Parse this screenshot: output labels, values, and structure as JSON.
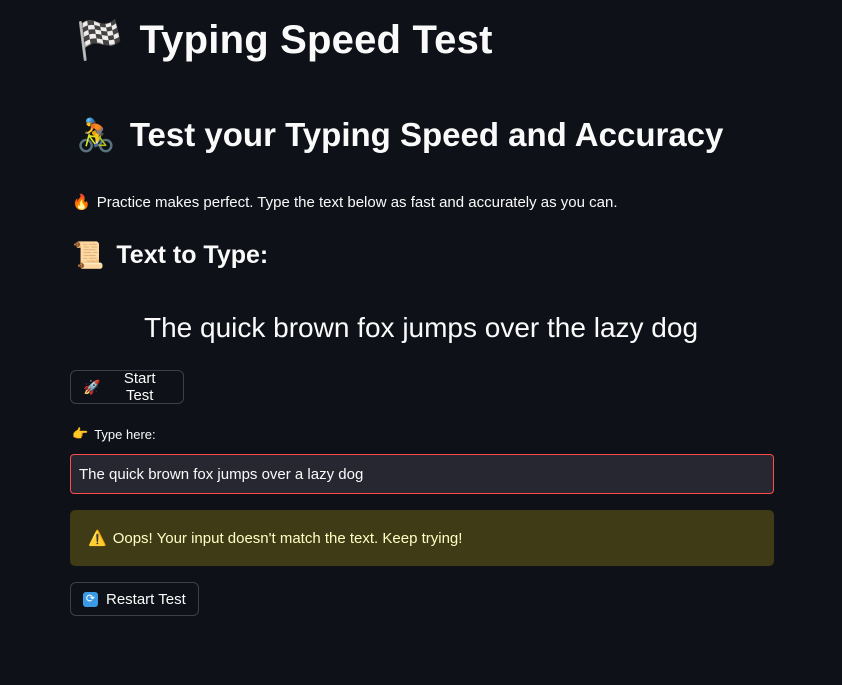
{
  "title": {
    "icon": "checkered-flag-icon",
    "icon_glyph": "🏁",
    "text": "Typing Speed Test"
  },
  "subheader": {
    "icon": "cyclist-icon",
    "icon_glyph": "🚴",
    "text": "Test your Typing Speed and Accuracy"
  },
  "practice": {
    "icon": "fire-icon",
    "icon_glyph": "🔥",
    "text": "Practice makes perfect. Type the text below as fast and accurately as you can."
  },
  "text_section": {
    "icon": "scroll-icon",
    "icon_glyph": "📜",
    "heading": "Text to Type:",
    "target": "The quick brown fox jumps over the lazy dog"
  },
  "start_button": {
    "icon": "rocket-icon",
    "icon_glyph": "🚀",
    "label": "Start Test"
  },
  "input": {
    "label_icon": "pointing-hand-icon",
    "label_icon_glyph": "👉",
    "label": "Type here:",
    "value": "The quick brown fox jumps over a lazy dog"
  },
  "warning": {
    "icon": "warning-icon",
    "icon_glyph": "⚠️",
    "text": "Oops! Your input doesn't match the text. Keep trying!"
  },
  "restart_button": {
    "icon": "refresh-icon",
    "icon_glyph": "🔄",
    "label": "Restart Test"
  },
  "colors": {
    "background": "#0e1117",
    "input_error_border": "#ff4b4b",
    "warning_background": "#3e3b16",
    "warning_text": "#ffffc2"
  }
}
